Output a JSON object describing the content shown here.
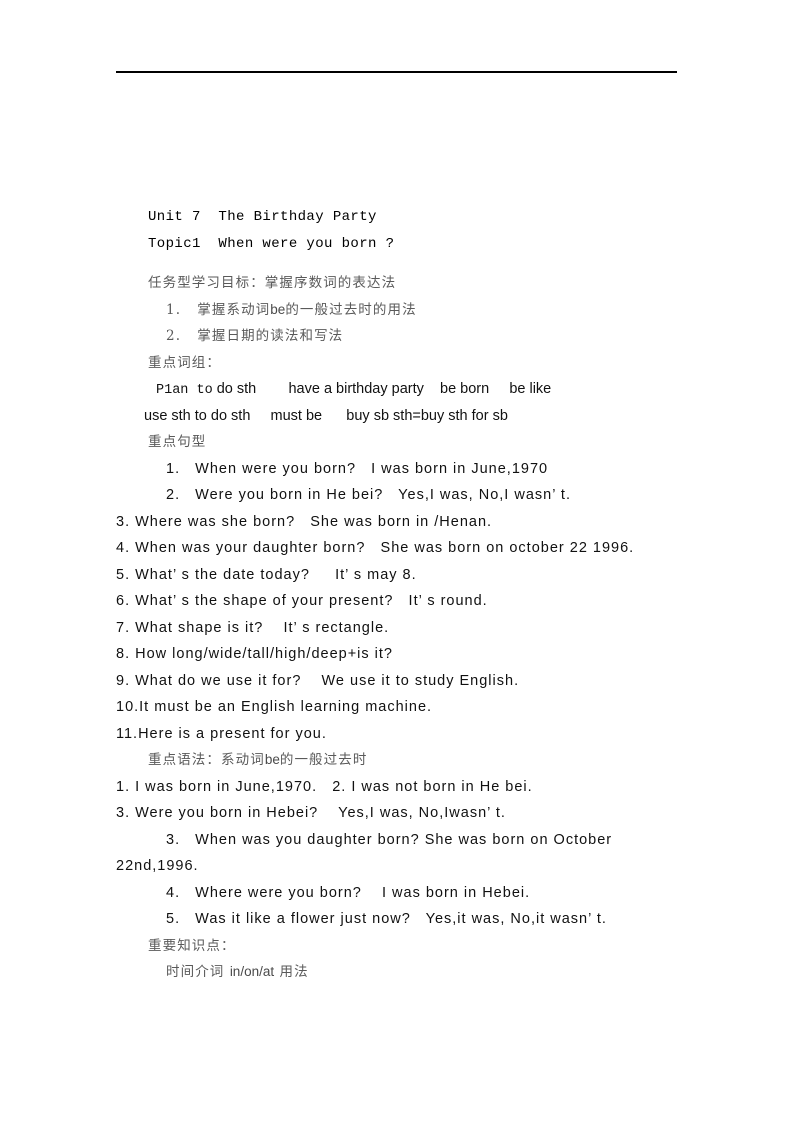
{
  "document": {
    "header_rule": true,
    "title_lines": [
      "Unit 7  The Birthday Party",
      "Topic1  When were you born ?"
    ],
    "objective_heading": "任务型学习目标：掌握序数词的表达法",
    "objectives": [
      {
        "num": "1.",
        "cjk_before": "掌握系动词",
        "en": "be",
        "cjk_after": "的一般过去时的用法"
      },
      {
        "num": "2.",
        "cjk_before": "掌握日期的读法和写法",
        "en": "",
        "cjk_after": ""
      }
    ],
    "phrases_heading": "重点词组：",
    "phrase_lines": [
      {
        "mono": "P1an to",
        "rest": " do sth        have a birthday party    be born     be like"
      },
      {
        "mono": "",
        "rest": "use sth to do sth     must be      buy sb sth=buy sth for sb"
      }
    ],
    "sentences_heading": "重点句型",
    "sentences": [
      "1.   When were you born?   I was born in June,1970",
      "2.   Were you born in He bei?   Yes,I was, No,I wasn’ t.",
      "3. Where was she born?   She was born in /Henan.",
      "4. When was your daughter born?   She was born on october 22 1996.",
      "5. What’ s the date today?     It’ s may 8.",
      "6. What’ s the shape of your present?   It’ s round.",
      "7. What shape is it?    It’ s rectangle.",
      "8. How long/wide/tall/high/deep+is it?",
      "9. What do we use it for?    We use it to study English.",
      "10.It must be an English learning machine.",
      "11.Here is a present for you."
    ],
    "grammar_heading": {
      "cjk_before": "重点语法：系动词",
      "en": "be",
      "cjk_after": "的一般过去时"
    },
    "grammar_lines": [
      {
        "text": "1. I was born in June,1970.   2. I was not born in He bei.",
        "indent": "none"
      },
      {
        "text": "3. Were you born in Hebei?    Yes,I was, No,Iwasn’ t.",
        "indent": "none"
      },
      {
        "text": "3.   When was you daughter born? She was born on October",
        "indent": "ind2"
      },
      {
        "text": "22nd,1996.",
        "indent": "none"
      },
      {
        "text": "4.   Where were you born?    I was born in Hebei.",
        "indent": "ind2"
      },
      {
        "text": "5.   Was it like a flower just now?   Yes,it was, No,it wasn’ t.",
        "indent": "ind2"
      }
    ],
    "keypoints_heading": "重要知识点：",
    "keypoints": [
      {
        "cjk_before": "时间介词",
        "en": "in/on/at",
        "cjk_after": "用法"
      }
    ]
  },
  "colors": {
    "page_background": "#ffffff",
    "body_text": "#111111",
    "cjk_text": "#5a5a5a",
    "rule": "#000000"
  }
}
